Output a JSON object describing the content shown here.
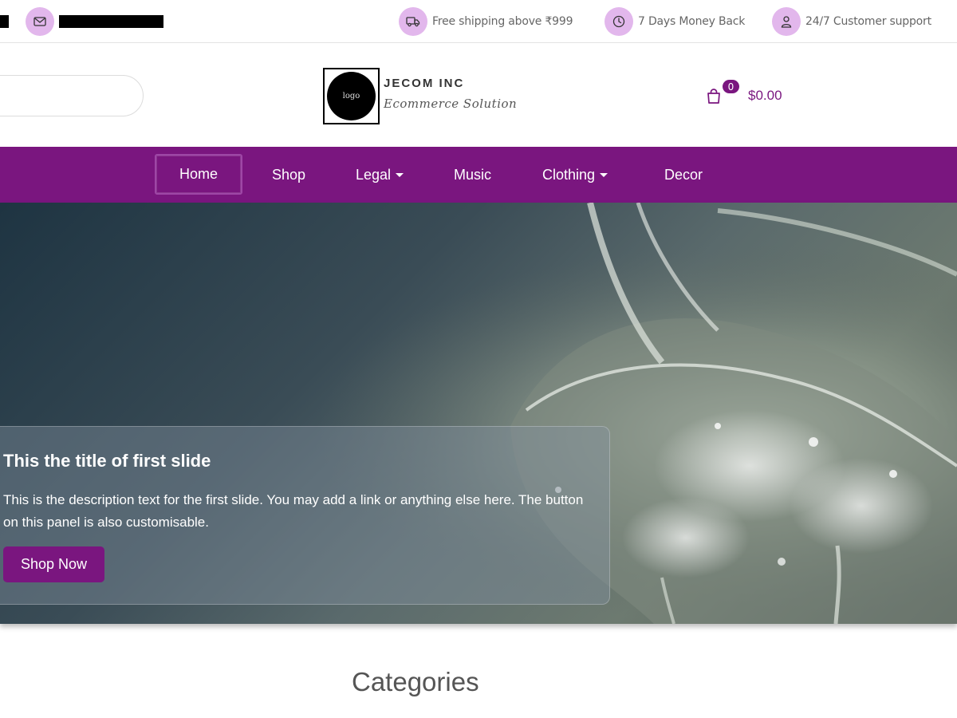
{
  "topbar": {
    "info": [
      {
        "icon": "truck-icon",
        "text": "Free shipping above ₹999"
      },
      {
        "icon": "clock-icon",
        "text": "7 Days Money Back"
      },
      {
        "icon": "user-icon",
        "text": "24/7 Customer support"
      }
    ]
  },
  "header": {
    "logo_text": "logo",
    "brand_name": "JECOM INC",
    "brand_tagline": "Ecommerce Solution",
    "cart_count": "0",
    "cart_total": "$0.00"
  },
  "nav": {
    "items": [
      {
        "label": "Home",
        "active": true
      },
      {
        "label": "Shop"
      },
      {
        "label": "Legal",
        "dropdown": true
      },
      {
        "label": "Music"
      },
      {
        "label": "Clothing",
        "dropdown": true
      },
      {
        "label": "Decor"
      }
    ]
  },
  "hero": {
    "title": "This the title of first slide",
    "description": "This is the description text for the first slide. You may add a link or anything else here. The button on this panel is also customisable.",
    "button_label": "Shop Now"
  },
  "categories": {
    "title": "Categories"
  },
  "colors": {
    "brand": "#7a167f",
    "icon_circle": "#e2b7ec"
  }
}
